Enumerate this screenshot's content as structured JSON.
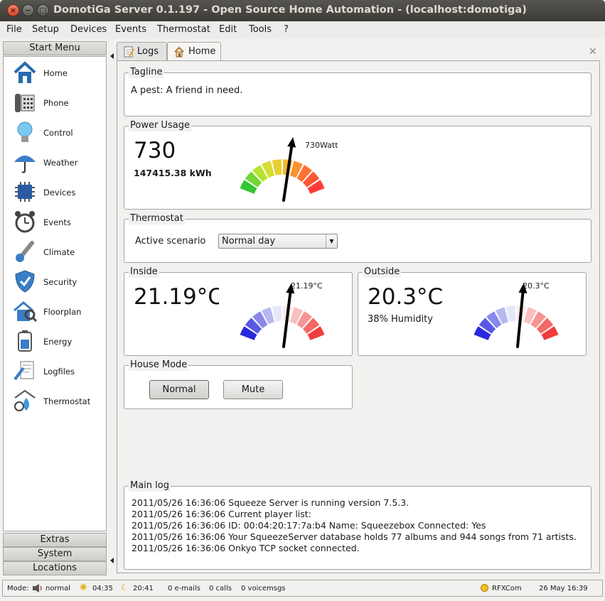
{
  "window": {
    "title": "DomotiGa Server 0.1.197 - Open Source Home Automation - (localhost:domotiga)"
  },
  "menubar": [
    "File",
    "Setup",
    "Devices",
    "Events",
    "Thermostat",
    "Edit",
    "Tools",
    "?"
  ],
  "sidebar": {
    "start_menu": "Start Menu",
    "items": [
      {
        "label": "Home",
        "icon": "home-icon"
      },
      {
        "label": "Phone",
        "icon": "phone-icon"
      },
      {
        "label": "Control",
        "icon": "lightbulb-icon"
      },
      {
        "label": "Weather",
        "icon": "umbrella-icon"
      },
      {
        "label": "Devices",
        "icon": "chip-icon"
      },
      {
        "label": "Events",
        "icon": "alarm-clock-icon"
      },
      {
        "label": "Climate",
        "icon": "thermometer-icon"
      },
      {
        "label": "Security",
        "icon": "shield-icon"
      },
      {
        "label": "Floorplan",
        "icon": "floorplan-icon"
      },
      {
        "label": "Energy",
        "icon": "battery-icon"
      },
      {
        "label": "Logfiles",
        "icon": "logfile-icon"
      },
      {
        "label": "Thermostat",
        "icon": "thermostat-icon"
      }
    ],
    "extras": "Extras",
    "system": "System",
    "locations": "Locations"
  },
  "tabs": [
    {
      "label": "Logs",
      "icon": "log-icon"
    },
    {
      "label": "Home",
      "icon": "home-icon"
    }
  ],
  "tagline": {
    "title": "Tagline",
    "text": "A pest: A friend in need."
  },
  "power": {
    "title": "Power Usage",
    "value": "730",
    "kwh": "147415.38 kWh",
    "gauge_label": "730Watt",
    "gauge_fraction": 0.56
  },
  "thermostat": {
    "title": "Thermostat",
    "label": "Active scenario",
    "selected": "Normal day"
  },
  "inside": {
    "title": "Inside",
    "value": "21.19°C",
    "gauge_label": "21.19°C",
    "gauge_fraction": 0.55
  },
  "outside": {
    "title": "Outside",
    "value": "20.3°C",
    "humidity": "38% Humidity",
    "gauge_label": "20.3°C",
    "gauge_fraction": 0.54
  },
  "house_mode": {
    "title": "House Mode",
    "normal": "Normal",
    "mute": "Mute"
  },
  "main_log": {
    "title": "Main log",
    "lines": [
      "2011/05/26 16:36:06 Squeeze Server is running version 7.5.3.",
      "2011/05/26 16:36:06 Current player list:",
      "2011/05/26 16:36:06 ID: 00:04:20:17:7a:b4 Name: Squeezebox Connected: Yes",
      "2011/05/26 16:36:06 Your SqueezeServer database holds 77 albums and 944 songs from 71 artists.",
      "2011/05/26 16:36:06 Onkyo TCP socket connected."
    ]
  },
  "status": {
    "mode_label": "Mode:",
    "mode": "normal",
    "sunrise": "04:35",
    "sunset": "20:41",
    "emails": "0 e-mails",
    "calls": "0 calls",
    "voicemsgs": "0 voicemsgs",
    "rfxcom": "RFXCom",
    "datetime": "26 May 16:39"
  },
  "colors": {
    "gauge_power": [
      "#32c832",
      "#c8e632",
      "#f0c832",
      "#ff7830",
      "#ff3c3c"
    ],
    "gauge_temp": [
      "#2828dc",
      "#ffffff",
      "#f03c3c"
    ]
  }
}
